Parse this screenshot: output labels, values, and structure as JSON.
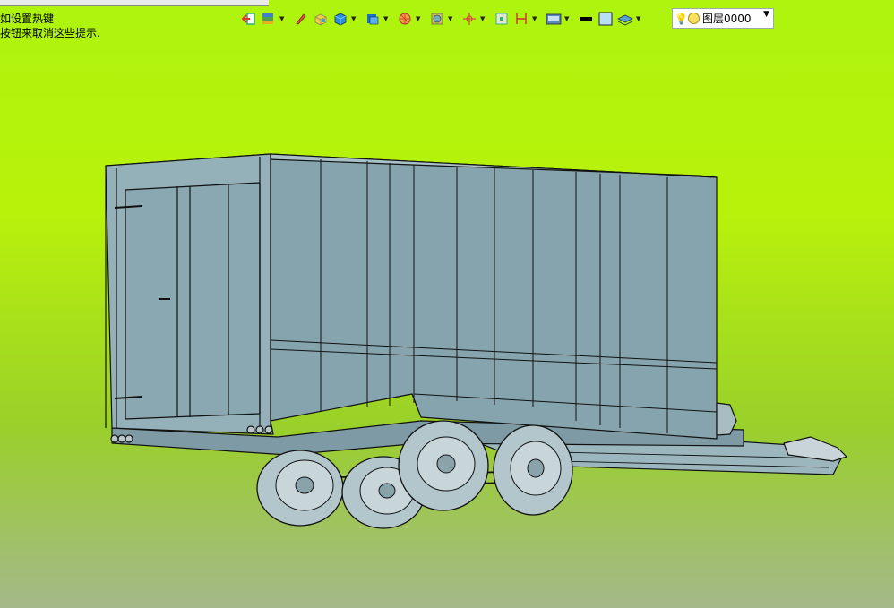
{
  "window": {
    "title": ""
  },
  "hints": {
    "line1": "如设置热键",
    "line2": "按钮来取消这些提示."
  },
  "toolbar": {
    "icons": [
      "exit-icon",
      "layers-stack-icon",
      "pencil-icon",
      "box-yellow-icon",
      "cube-blue-icon",
      "shaded-cube-icon",
      "sphere-cut-icon",
      "frame-icon",
      "axis-point-icon",
      "select-box-icon",
      "dimension-icon",
      "render-icon",
      "color-swatch-black-icon",
      "square-light-blue-icon",
      "layer-fill-icon"
    ]
  },
  "layer": {
    "name": "图层0000"
  },
  "colors": {
    "viewport_top": "#aef40e",
    "viewport_bottom": "#a4b88a",
    "model_fill": "#88a6b0",
    "model_stroke": "#111111"
  }
}
